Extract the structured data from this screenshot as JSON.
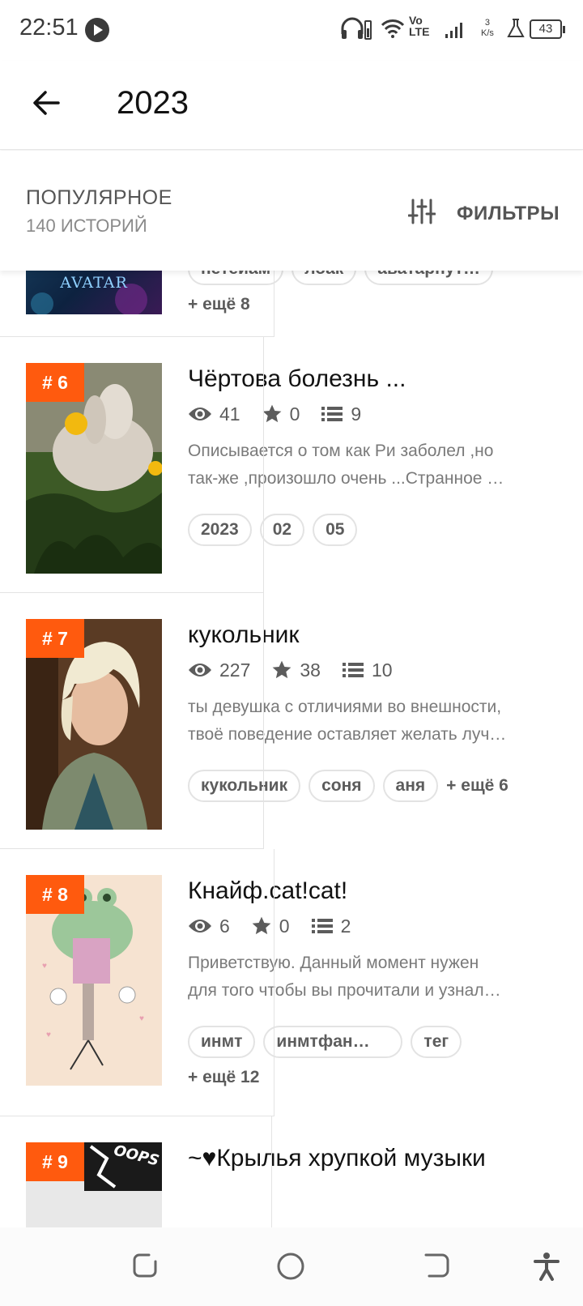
{
  "status_bar": {
    "time": "22:51",
    "network_top": "Vo",
    "network_bottom": "LTE",
    "speed_value": "3",
    "speed_unit": "K/s",
    "battery": "43"
  },
  "header": {
    "back_icon": "arrow-left-icon",
    "title": "2023"
  },
  "sort": {
    "label": "ПОПУЛЯРНОЕ",
    "count": "140 ИСТОРИЙ",
    "filter_icon": "sliders-icon",
    "filter_label": "ФИЛЬТРЫ"
  },
  "stories": [
    {
      "cover_text": "AVATAR",
      "tags": [
        "нетеиам",
        "лоак",
        "аватарпут…"
      ],
      "more": "+ ещё 8"
    },
    {
      "rank": "# 6",
      "title": "Чёртова болезнь ...",
      "views": "41",
      "stars": "0",
      "chapters": "9",
      "desc_line1": "Описывается о том как Ри заболел ,но",
      "desc_line2": "так-же ,произошло очень ...Странное …",
      "tags": [
        "2023",
        "02",
        "05"
      ],
      "more": ""
    },
    {
      "rank": "# 7",
      "title": "кукольник",
      "views": "227",
      "stars": "38",
      "chapters": "10",
      "desc_line1": "ты девушка с отличиями во внешности,",
      "desc_line2": "твоё поведение оставляет желать луч…",
      "tags": [
        "кукольник",
        "соня",
        "аня"
      ],
      "more": "+ ещё 6"
    },
    {
      "rank": "# 8",
      "title": "Кнайф.cat!cat!",
      "views": "6",
      "stars": "0",
      "chapters": "2",
      "desc_line1": "Приветствую. Данный момент нужен",
      "desc_line2": "для того чтобы вы прочитали и узнал…",
      "tags": [
        "инмт",
        "инмтфан…",
        "тег"
      ],
      "more": "+ ещё 12"
    },
    {
      "rank": "# 9",
      "title": "~♥Крылья хрупкой музыки",
      "cover_text": "OOPS"
    }
  ],
  "colors": {
    "accent": "#ff5a0e",
    "text_primary": "#121212",
    "text_secondary": "#5c5c5c"
  }
}
